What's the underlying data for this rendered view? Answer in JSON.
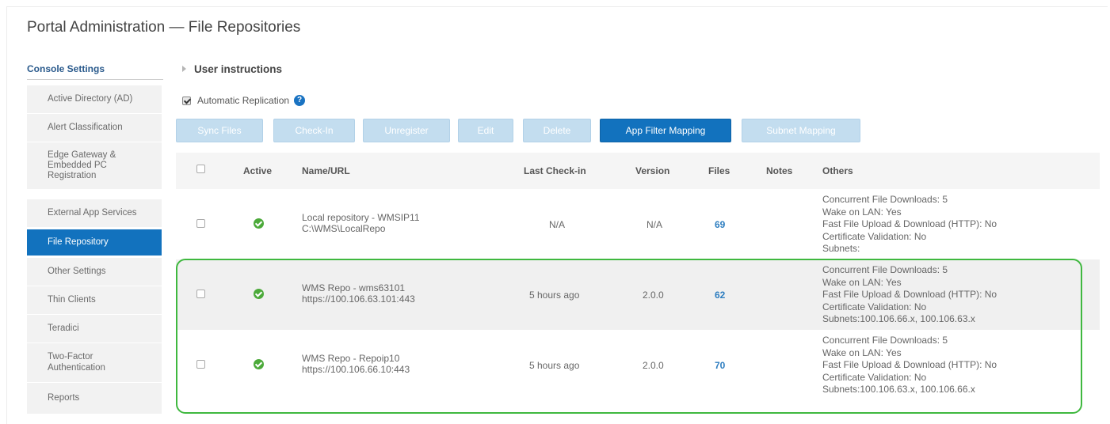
{
  "page": {
    "title": "Portal Administration — File Repositories"
  },
  "sidebar": {
    "header": "Console Settings",
    "items": [
      {
        "label": "Active Directory (AD)"
      },
      {
        "label": "Alert Classification"
      },
      {
        "label": "Edge Gateway & Embedded PC Registration"
      },
      {
        "label": "External App Services"
      },
      {
        "label": "File Repository"
      },
      {
        "label": "Other Settings"
      },
      {
        "label": "Thin Clients"
      },
      {
        "label": "Teradici"
      },
      {
        "label": "Two-Factor Authentication"
      },
      {
        "label": "Reports"
      }
    ]
  },
  "main": {
    "user_instructions": "User instructions",
    "auto_replication": {
      "label": "Automatic Replication",
      "checked": true,
      "help_icon": "?"
    },
    "toolbar": {
      "sync_files": "Sync Files",
      "check_in": "Check-In",
      "unregister": "Unregister",
      "edit": "Edit",
      "delete": "Delete",
      "app_filter_mapping": "App Filter Mapping",
      "subnet_mapping": "Subnet Mapping"
    },
    "table": {
      "columns": {
        "active": "Active",
        "name_url": "Name/URL",
        "last_checkin": "Last Check-in",
        "version": "Version",
        "files": "Files",
        "notes": "Notes",
        "others": "Others"
      },
      "rows": [
        {
          "name": "Local repository - WMSIP11",
          "url": "C:\\WMS\\LocalRepo",
          "last_checkin": "N/A",
          "version": "N/A",
          "files": "69",
          "notes": "",
          "others": [
            "Concurrent File Downloads: 5",
            "Wake on LAN: Yes",
            "Fast File Upload & Download (HTTP): No",
            "Certificate Validation: No",
            "Subnets:"
          ]
        },
        {
          "name": "WMS Repo - wms63101",
          "url": "https://100.106.63.101:443",
          "last_checkin": "5 hours ago",
          "version": "2.0.0",
          "files": "62",
          "notes": "",
          "others": [
            "Concurrent File Downloads: 5",
            "Wake on LAN: Yes",
            "Fast File Upload & Download (HTTP): No",
            "Certificate Validation: No",
            "Subnets:100.106.66.x, 100.106.63.x"
          ]
        },
        {
          "name": "WMS Repo - Repoip10",
          "url": "https://100.106.66.10:443",
          "last_checkin": "5 hours ago",
          "version": "2.0.0",
          "files": "70",
          "notes": "",
          "others": [
            "Concurrent File Downloads: 5",
            "Wake on LAN: Yes",
            "Fast File Upload & Download (HTTP): No",
            "Certificate Validation: No",
            "Subnets:100.106.63.x, 100.106.66.x"
          ]
        }
      ]
    }
  },
  "colors": {
    "primary": "#1272be",
    "disabled_button": "#c3ddef",
    "highlight": "#3fb83f",
    "active_ok": "#4caa3a",
    "link": "#2e7ec0"
  }
}
